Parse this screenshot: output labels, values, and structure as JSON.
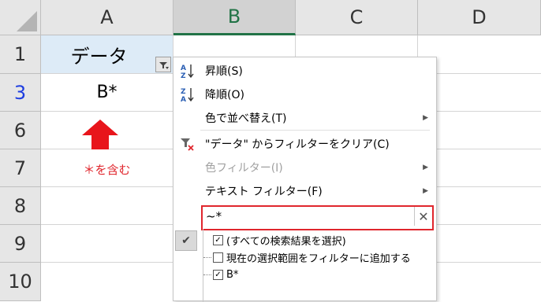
{
  "columns": [
    "A",
    "B",
    "C",
    "D"
  ],
  "rows": [
    "1",
    "3",
    "6",
    "7",
    "8",
    "9",
    "10"
  ],
  "cells": {
    "a1": "データ",
    "a3": "B*",
    "a7": "＊を含む"
  },
  "menu": {
    "sort_asc": "昇順(S)",
    "sort_desc": "降順(O)",
    "sort_color": "色で並べ替え(T)",
    "clear_filter": "\"データ\" からフィルターをクリア(C)",
    "color_filter": "色フィルター(I)",
    "text_filter": "テキスト フィルター(F)",
    "search_value": "~*",
    "tree_items": [
      {
        "label": "(すべての検索結果を選択)",
        "checked": true
      },
      {
        "label": "現在の選択範囲をフィルターに追加する",
        "checked": false
      },
      {
        "label": "B*",
        "checked": true
      }
    ]
  },
  "colors": {
    "accent": "#217346",
    "red": "#e0262d",
    "row_blue": "#1f3ee0"
  }
}
